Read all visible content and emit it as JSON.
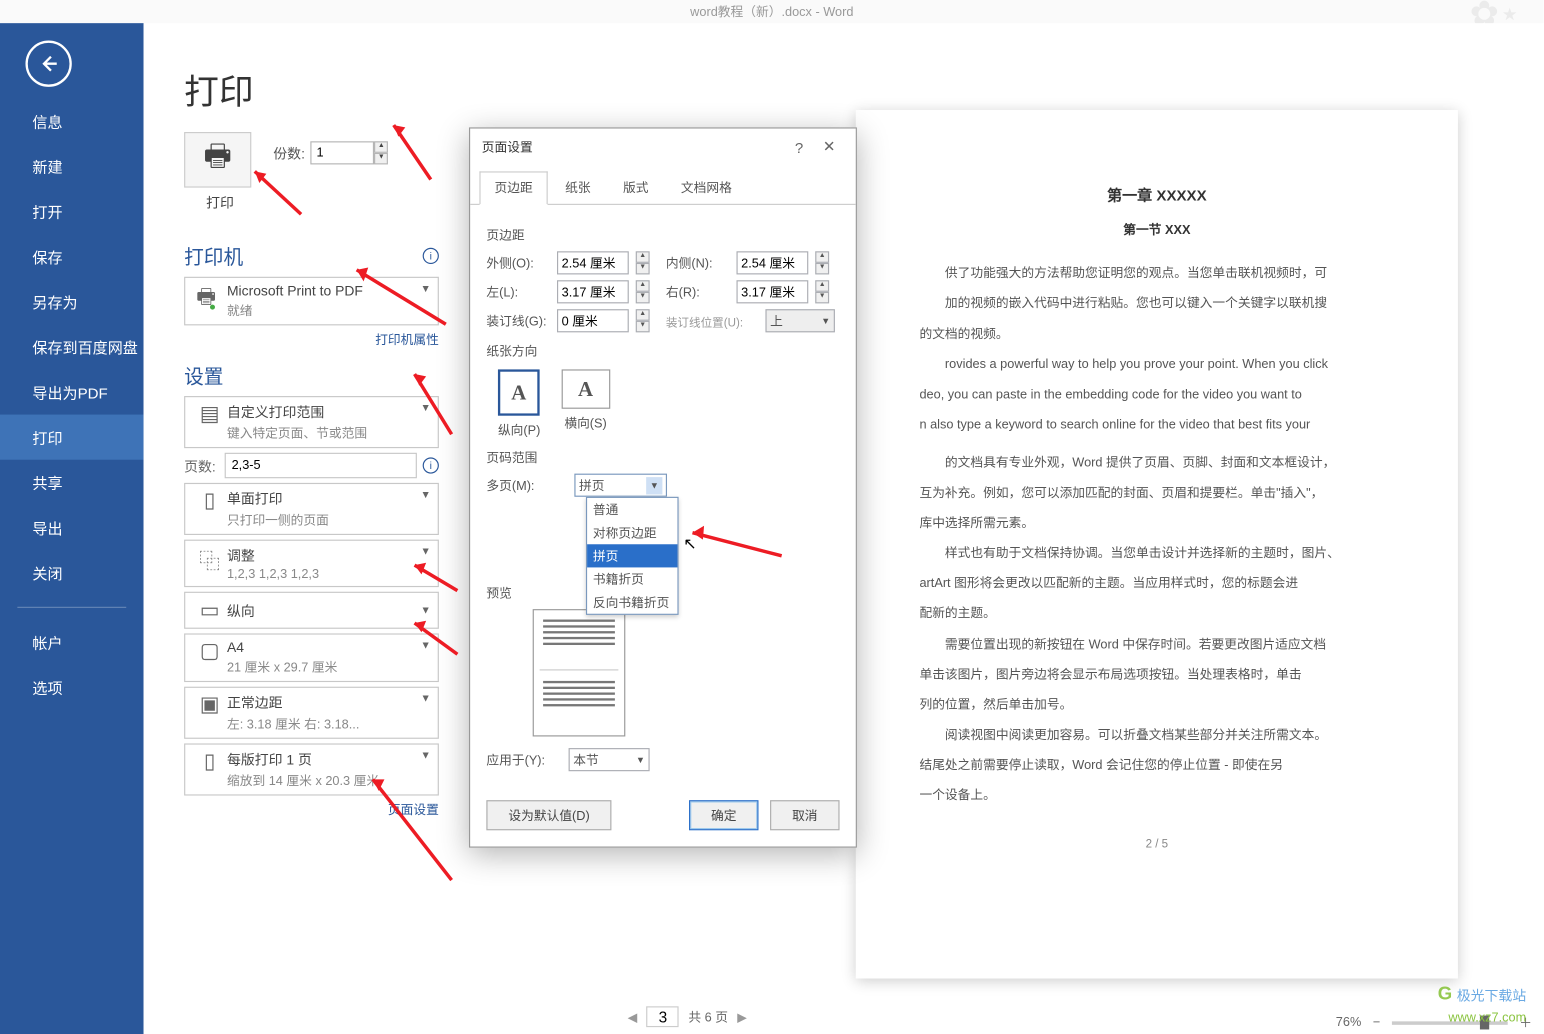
{
  "titlebar": {
    "title": "word教程（新）.docx - Word"
  },
  "sidebar": {
    "items": [
      {
        "label": "信息"
      },
      {
        "label": "新建"
      },
      {
        "label": "打开"
      },
      {
        "label": "保存"
      },
      {
        "label": "另存为"
      },
      {
        "label": "保存到百度网盘"
      },
      {
        "label": "导出为PDF"
      },
      {
        "label": "打印"
      },
      {
        "label": "共享"
      },
      {
        "label": "导出"
      },
      {
        "label": "关闭"
      },
      {
        "label": "帐户"
      },
      {
        "label": "选项"
      }
    ]
  },
  "main": {
    "heading": "打印",
    "print_button": "打印",
    "copies_label": "份数:",
    "copies_value": "1",
    "printer_heading": "打印机",
    "printer_name": "Microsoft Print to PDF",
    "printer_status": "就绪",
    "printer_props": "打印机属性",
    "settings_heading": "设置",
    "range": {
      "l1": "自定义打印范围",
      "l2": "键入特定页面、节或范围"
    },
    "pages_label": "页数:",
    "pages_value": "2,3-5",
    "sides": {
      "l1": "单面打印",
      "l2": "只打印一侧的页面"
    },
    "collate": {
      "l1": "调整",
      "l2": "1,2,3    1,2,3    1,2,3"
    },
    "orient": {
      "l1": "纵向"
    },
    "paper": {
      "l1": "A4",
      "l2": "21 厘米 x 29.7 厘米"
    },
    "margins": {
      "l1": "正常边距",
      "l2": "左:  3.18 厘米    右:  3.18..."
    },
    "perpage": {
      "l1": "每版打印 1 页",
      "l2": "缩放到 14 厘米 x 20.3 厘米"
    },
    "page_setup": "页面设置"
  },
  "dialog": {
    "title": "页面设置",
    "tabs": [
      "页边距",
      "纸张",
      "版式",
      "文档网格"
    ],
    "grp_margin": "页边距",
    "outer_label": "外侧(O):",
    "outer_val": "2.54 厘米",
    "inner_label": "内侧(N):",
    "inner_val": "2.54 厘米",
    "left_label": "左(L):",
    "left_val": "3.17 厘米",
    "right_label": "右(R):",
    "right_val": "3.17 厘米",
    "gutter_label": "装订线(G):",
    "gutter_val": "0 厘米",
    "gutterpos_label": "装订线位置(U):",
    "gutterpos_val": "上",
    "grp_orient": "纸张方向",
    "portrait": "纵向(P)",
    "landscape": "横向(S)",
    "grp_range": "页码范围",
    "multi_label": "多页(M):",
    "multi_val": "拼页",
    "dd_options": [
      "普通",
      "对称页边距",
      "拼页",
      "书籍折页",
      "反向书籍折页"
    ],
    "grp_preview": "预览",
    "apply_label": "应用于(Y):",
    "apply_val": "本节",
    "default_btn": "设为默认值(D)",
    "ok_btn": "确定",
    "cancel_btn": "取消"
  },
  "doc": {
    "h2": "第一章 XXXXX",
    "h3": "第一节 XXX",
    "p1": "供了功能强大的方法帮助您证明您的观点。当您单击联机视频时，可",
    "p2": "加的视频的嵌入代码中进行粘贴。您也可以键入一个关键字以联机搜",
    "p3": "的文档的视频。",
    "p4": "rovides a powerful way to help you prove your point. When you click",
    "p5": "deo, you can paste in the embedding code for the video you want to",
    "p6": "n also type a keyword to search online for the video that best fits your",
    "p7": "的文档具有专业外观，Word 提供了页眉、页脚、封面和文本框设计，",
    "p8": "互为补充。例如，您可以添加匹配的封面、页眉和提要栏。单击\"插入\"，",
    "p9": "库中选择所需元素。",
    "p10": "样式也有助于文档保持协调。当您单击设计并选择新的主题时，图片、",
    "p11": "artArt 图形将会更改以匹配新的主题。当应用样式时，您的标题会进",
    "p12": "配新的主题。",
    "p13": "需要位置出现的新按钮在 Word 中保存时间。若要更改图片适应文档",
    "p14": "单击该图片，图片旁边将会显示布局选项按钮。当处理表格时，单击",
    "p15": "列的位置，然后单击加号。",
    "p16": "阅读视图中阅读更加容易。可以折叠文档某些部分并关注所需文本。",
    "p17": "结尾处之前需要停止读取，Word 会记住您的停止位置 - 即使在另",
    "p18": "一个设备上。",
    "pn": "2 / 5"
  },
  "nav": {
    "page": "3",
    "total": "共 6 页"
  },
  "status": {
    "zoom": "76%"
  },
  "watermark": {
    "text": "极光下载站",
    "url": "www.xz7.com"
  }
}
